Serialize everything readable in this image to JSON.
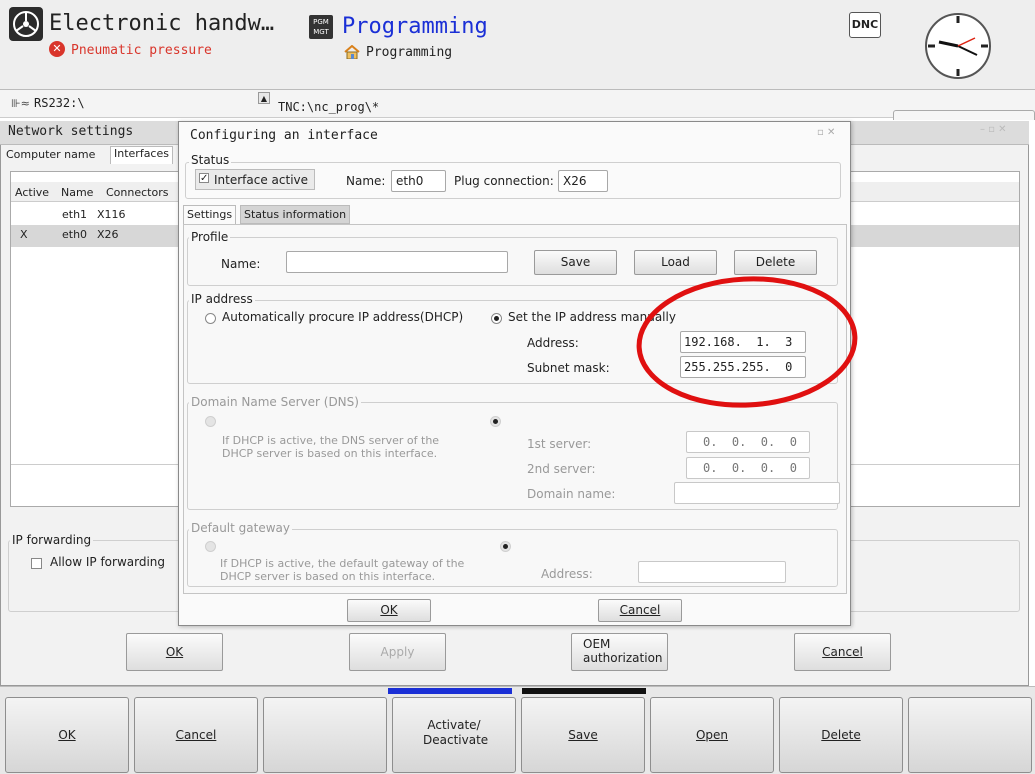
{
  "header": {
    "app_title": "Electronic handw…",
    "app_status": "Pneumatic pressure",
    "pgm_badge_line1": "PGM",
    "pgm_badge_line2": "MGT",
    "mode_title": "Programming",
    "mode_subtitle": "Programming",
    "dnc_label": "DNC",
    "left_path": "RS232:\\",
    "right_path": "TNC:\\nc_prog\\*"
  },
  "network_window": {
    "title": "Network settings",
    "tabs": [
      "Computer name",
      "Interfaces"
    ],
    "columns": [
      "Active",
      "Name",
      "Connectors"
    ],
    "rows": [
      {
        "active": "",
        "name": "eth1",
        "connector": "X116"
      },
      {
        "active": "X",
        "name": "eth0",
        "connector": "X26"
      }
    ],
    "ip_forwarding_title": "IP forwarding",
    "allow_ip_forwarding": "Allow IP forwarding",
    "buttons": {
      "ok": "OK",
      "apply": "Apply",
      "oem_line1": "OEM",
      "oem_line2": "authorization",
      "cancel": "Cancel"
    }
  },
  "dialog": {
    "title": "Configuring an interface",
    "status_title": "Status",
    "interface_active": "Interface active",
    "name_label": "Name:",
    "name_value": "eth0",
    "plug_label": "Plug connection:",
    "plug_value": "X26",
    "tabs": [
      "Settings",
      "Status information"
    ],
    "profile": {
      "title": "Profile",
      "name_label": "Name:",
      "name_value": "",
      "save": "Save",
      "load": "Load",
      "delete": "Delete"
    },
    "ip": {
      "title": "IP address",
      "auto_label": "Automatically procure IP address(DHCP)",
      "manual_label": "Set the IP address manually",
      "address_label": "Address:",
      "address_value": "192.168.  1.  3",
      "subnet_label": "Subnet mask:",
      "subnet_value": "255.255.255.  0"
    },
    "dns": {
      "title": "Domain Name Server (DNS)",
      "dhcp_note": "If DHCP is active, the DNS server of the DHCP server is based on this interface.",
      "server1_label": "1st server:",
      "server1_value": "0.  0.  0.  0",
      "server2_label": "2nd server:",
      "server2_value": "0.  0.  0.  0",
      "domain_label": "Domain name:",
      "domain_value": ""
    },
    "gateway": {
      "title": "Default gateway",
      "dhcp_note": "If DHCP is active, the default gateway of the DHCP server is based on this interface.",
      "address_label": "Address:",
      "address_value": ""
    },
    "ok": "OK",
    "cancel": "Cancel"
  },
  "softkeys": [
    "OK",
    "Cancel",
    "",
    "Activate/ Deactivate",
    "Save",
    "Open",
    "Delete",
    ""
  ],
  "colors": {
    "accent_blue": "#1a2fd6",
    "highlight_red": "#e01010",
    "error_red": "#d9352b"
  }
}
